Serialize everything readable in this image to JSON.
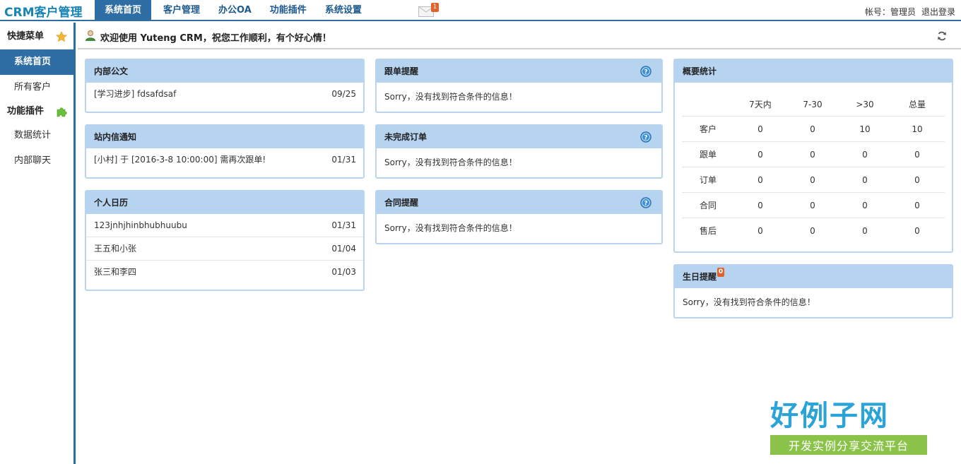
{
  "app": {
    "brand": "CRM客户管理"
  },
  "nav": [
    {
      "label": "系统首页",
      "active": true
    },
    {
      "label": "客户管理"
    },
    {
      "label": "办公OA"
    },
    {
      "label": "功能插件"
    },
    {
      "label": "系统设置"
    }
  ],
  "mail": {
    "badge": "1"
  },
  "account": {
    "label": "帐号：管理员",
    "logout": "退出登录"
  },
  "sidebar": {
    "quick_menu": "快捷菜单",
    "items_top": [
      {
        "label": "系统首页"
      },
      {
        "label": "所有客户"
      }
    ],
    "plugins": "功能插件",
    "items_bottom": [
      {
        "label": "数据统计"
      },
      {
        "label": "内部聊天"
      }
    ]
  },
  "welcome": {
    "text": "欢迎使用 Yuteng CRM，祝您工作顺利，有个好心情！"
  },
  "panels": {
    "internal_doc": {
      "title": "内部公文",
      "rows": [
        {
          "text": "[学习进步] fdsafdsaf",
          "date": "09/25"
        }
      ]
    },
    "site_msg": {
      "title": "站内信通知",
      "rows": [
        {
          "text": "[小村] 于 [2016-3-8 10:00:00] 需再次跟单!",
          "date": "01/31"
        }
      ]
    },
    "calendar": {
      "title": "个人日历",
      "rows": [
        {
          "text": "123jnhjhinbhubhuubu",
          "date": "01/31"
        },
        {
          "text": "王五和小张",
          "date": "01/04"
        },
        {
          "text": "张三和李四",
          "date": "01/03"
        }
      ]
    },
    "follow": {
      "title": "跟单提醒",
      "empty": "Sorry，没有找到符合条件的信息！"
    },
    "orders": {
      "title": "未完成订单",
      "empty": "Sorry，没有找到符合条件的信息！"
    },
    "contracts": {
      "title": "合同提醒",
      "empty": "Sorry，没有找到符合条件的信息！"
    },
    "summary": {
      "title": "概要统计",
      "columns": [
        "",
        "7天内",
        "7-30",
        ">30",
        "总量"
      ],
      "rows": [
        [
          "客户",
          "0",
          "0",
          "10",
          "10"
        ],
        [
          "跟单",
          "0",
          "0",
          "0",
          "0"
        ],
        [
          "订单",
          "0",
          "0",
          "0",
          "0"
        ],
        [
          "合同",
          "0",
          "0",
          "0",
          "0"
        ],
        [
          "售后",
          "0",
          "0",
          "0",
          "0"
        ]
      ]
    },
    "birthday": {
      "title": "生日提醒",
      "badge": "0",
      "empty": "Sorry，没有找到符合条件的信息！"
    }
  },
  "watermark": {
    "title": "好例子网",
    "subtitle": "开发实例分享交流平台"
  },
  "colors": {
    "accent": "#2f6ea5",
    "panel_head": "#b6d3f0",
    "badge": "#e2622c"
  }
}
